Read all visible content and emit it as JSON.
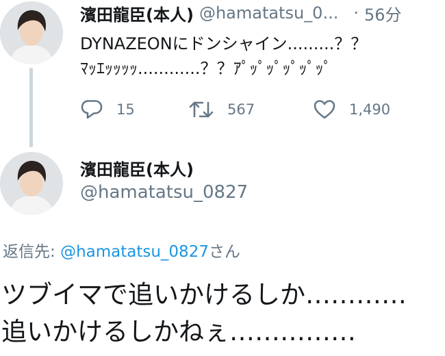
{
  "tweet": {
    "author_name": "濱田龍臣(本人)",
    "author_handle": "@hamatatsu_0...",
    "separator": "·",
    "time": "56分",
    "text_line1": "DYNAZEONにドンシャイン.........？？",
    "text_line2": "ﾏｯｴｯｯｯｯ............？？ｱﾟｯﾟｯﾟｯﾟｯﾟｯﾟ",
    "actions": {
      "reply_count": "15",
      "retweet_count": "567",
      "like_count": "1,490"
    }
  },
  "main_tweet": {
    "author_name": "濱田龍臣(本人)",
    "author_handle": "@hamatatsu_0827",
    "reply_prefix": "返信先: ",
    "reply_mention": "@hamatatsu_0827",
    "reply_suffix": "さん",
    "text_line1": "ツブイマで追いかけるしか…………",
    "text_line2": "追いかけるしかねぇ……………"
  },
  "colors": {
    "text": "#14171a",
    "secondary": "#657786",
    "link": "#1b95e0",
    "thread_line": "#ccd6dd"
  },
  "icons": [
    "reply-icon",
    "retweet-icon",
    "like-icon"
  ]
}
